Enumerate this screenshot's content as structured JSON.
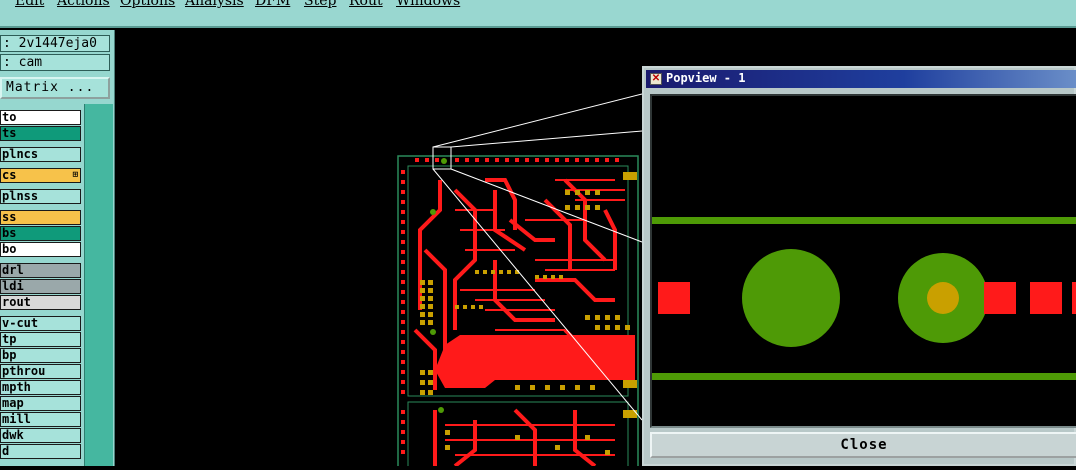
{
  "menu": [
    "Edit",
    "Actions",
    "Options",
    "Analysis",
    "DFM",
    "Step",
    "Rout",
    "Windows"
  ],
  "sidebar": {
    "job": ": 2v1447eja0",
    "step": ": cam",
    "matrix_button": "Matrix ...",
    "layers": [
      {
        "label": "to",
        "color": "#ffffff"
      },
      {
        "label": "ts",
        "color": "#0f9a7a"
      },
      {
        "label": "plncs",
        "color": "#a6e2da"
      },
      {
        "label": "cs",
        "color": "#f7c24a",
        "mark": "⊞"
      },
      {
        "label": "plnss",
        "color": "#a6e2da"
      },
      {
        "label": "ss",
        "color": "#f7c24a"
      },
      {
        "label": "bs",
        "color": "#0f9a7a"
      },
      {
        "label": "bo",
        "color": "#ffffff"
      },
      {
        "label": "drl",
        "color": "#9aa8aa"
      },
      {
        "label": "ldi",
        "color": "#9aa8aa"
      },
      {
        "label": "rout",
        "color": "#d9d9d9"
      },
      {
        "label": "v-cut",
        "color": "#a6e2da"
      },
      {
        "label": "tp",
        "color": "#a6e2da"
      },
      {
        "label": "bp",
        "color": "#a6e2da"
      },
      {
        "label": "pthrou",
        "color": "#a6e2da"
      },
      {
        "label": "mpth",
        "color": "#a6e2da"
      },
      {
        "label": "map",
        "color": "#a6e2da"
      },
      {
        "label": "mill",
        "color": "#a6e2da"
      },
      {
        "label": "dwk",
        "color": "#a6e2da"
      },
      {
        "label": "d",
        "color": "#a6e2da"
      }
    ]
  },
  "popview": {
    "title": "Popview - 1",
    "close_label": "Close"
  },
  "colors": {
    "copper": "#ff1a1a",
    "pad": "#4e9a06",
    "drill": "#c9a000",
    "menubar": "#99d7d0"
  }
}
